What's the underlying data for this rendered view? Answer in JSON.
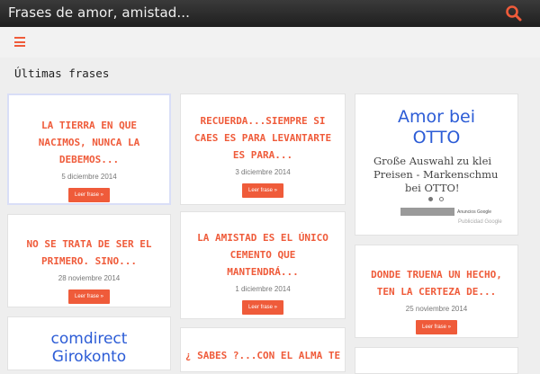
{
  "header": {
    "site_title": "Frases de amor, amistad...",
    "search_icon": "search-icon",
    "menu_icon": "hamburger-menu-icon"
  },
  "section": {
    "title": "Últimas frases"
  },
  "cards": [
    {
      "title_lines": [
        "LA TIERRA EN QUE",
        "NACIMOS, NUNCA LA",
        "DEBEMOS..."
      ],
      "date": "5 diciembre 2014",
      "button": "Leer frase »"
    },
    {
      "title_lines": [
        "RECUERDA...SIEMPRE SI",
        "CAES ES PARA LEVANTARTE",
        "ES PARA..."
      ],
      "date": "3 diciembre 2014",
      "button": "Leer frase »"
    },
    {
      "title_lines": [
        "NO SE TRATA DE SER EL",
        "PRIMERO. SINO..."
      ],
      "date": "28 noviembre 2014",
      "button": "Leer frase »"
    },
    {
      "title_lines": [
        "LA AMISTAD ES EL ÚNICO",
        "CEMENTO QUE",
        "MANTENDRÁ..."
      ],
      "date": "1 diciembre 2014",
      "button": "Leer frase »"
    },
    {
      "title_lines": [
        "DONDE TRUENA UN HECHO,",
        "TEN LA CERTEZA DE..."
      ],
      "date": "25 noviembre 2014",
      "button": "Leer frase »"
    },
    {
      "title_lines": [
        "¿ SABES ?...CON EL ALMA TE"
      ],
      "date": "",
      "button": ""
    }
  ],
  "ads": {
    "otto": {
      "title_lines": [
        "Amor bei",
        "OTTO"
      ],
      "text_lines": [
        "Große Auswahl zu klei",
        "Preisen - Markenschmu",
        "bei OTTO!"
      ],
      "adchoices": "Anuncios Google",
      "footer": "Publicidad Google"
    },
    "comdirect": {
      "title_lines": [
        "comdirect",
        "Girokonto"
      ]
    }
  },
  "colors": {
    "accent": "#ef5b3a",
    "ad_link": "#2c5cd6",
    "topbar": "#2a2a2a"
  }
}
